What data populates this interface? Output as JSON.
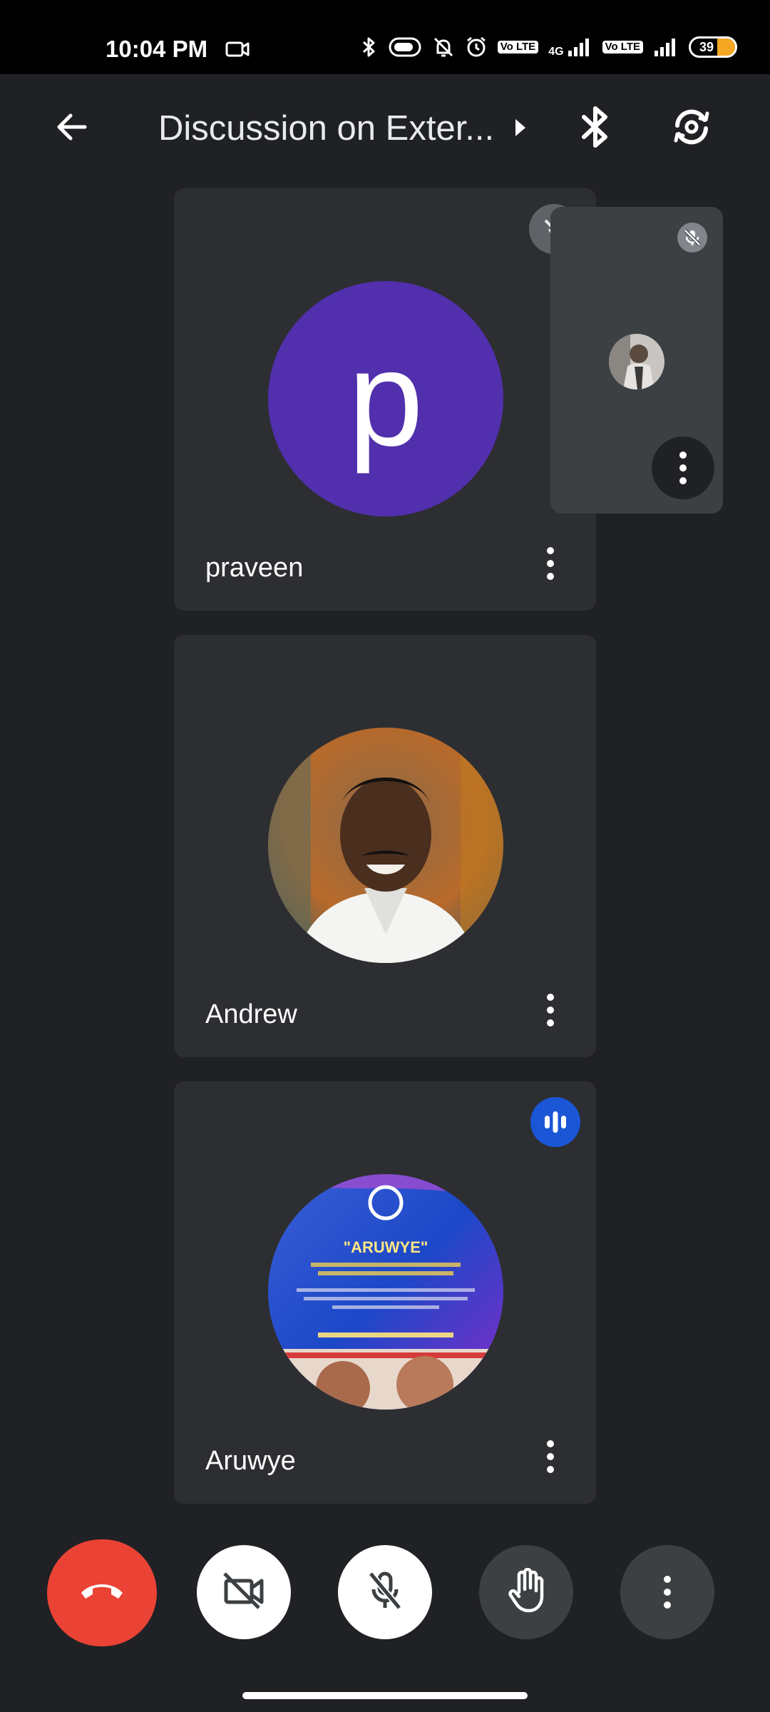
{
  "status_bar": {
    "time": "10:04 PM",
    "lte_1": "Vo LTE",
    "network_1": "4G",
    "lte_2": "Vo LTE",
    "battery_level": "39",
    "battery_color": "#f5a623"
  },
  "header": {
    "title": "Discussion on Exter...",
    "back_icon": "arrow-left-icon",
    "expand_icon": "triangle-right-icon",
    "audio_icon": "bluetooth-icon",
    "switch_camera_icon": "camera-flip-icon"
  },
  "participants": [
    {
      "name": "praveen",
      "avatar_letter": "p",
      "avatar_color": "#512fad",
      "status_icon": "mic-off-icon"
    },
    {
      "name": "Andrew",
      "avatar_type": "photo"
    },
    {
      "name": "Aruwye",
      "avatar_type": "photo",
      "status_icon": "speaking-icon",
      "status_color": "#1a56d6",
      "avatar_logo_text": "\"ARUWYE\""
    }
  ],
  "self_view": {
    "status_icon": "mic-off-icon"
  },
  "controls": {
    "end_call_color": "#ea4335",
    "end_call_icon": "hang-up-icon",
    "camera_icon": "camera-off-icon",
    "mic_icon": "mic-off-icon",
    "hand_icon": "raise-hand-icon",
    "more_icon": "more-vert-icon"
  }
}
